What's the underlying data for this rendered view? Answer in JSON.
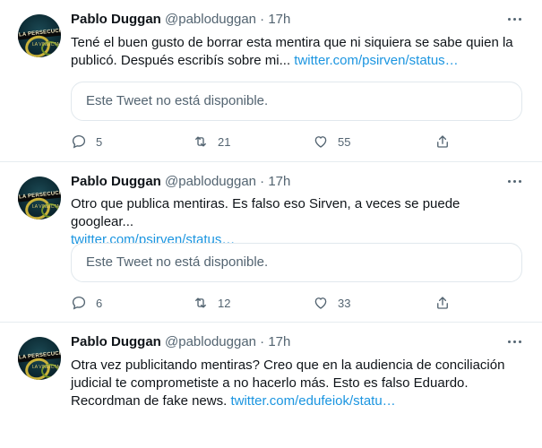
{
  "tweets": [
    {
      "author": "Pablo Duggan",
      "handle": "@pabloduggan",
      "separator": "·",
      "time": "17h",
      "avatar_text": "LA PERSECUCIÓN",
      "avatar_sub": "LA VINDICTA",
      "text_line1": "Tené el buen gusto de borrar esta mentira que ni siquiera se sabe quien la",
      "text_line2": "publicó. Después escribís sobre mi... ",
      "link": "twitter.com/psirven/status…",
      "quote": "Este Tweet no está disponible.",
      "replies": "5",
      "retweets": "21",
      "likes": "55"
    },
    {
      "author": "Pablo Duggan",
      "handle": "@pabloduggan",
      "separator": "·",
      "time": "17h",
      "avatar_text": "LA PERSECUCIÓN",
      "avatar_sub": "LA VINDICTA",
      "text_line1": "Otro que publica mentiras. Es falso eso Sirven, a veces se puede googlear...",
      "link": "twitter.com/psirven/status…",
      "quote": "Este Tweet no está disponible.",
      "replies": "6",
      "retweets": "12",
      "likes": "33"
    },
    {
      "author": "Pablo Duggan",
      "handle": "@pabloduggan",
      "separator": "·",
      "time": "17h",
      "avatar_text": "LA PERSECUCIÓN",
      "avatar_sub": "LA VINDICTA",
      "text_line1": "Otra vez publicitando mentiras? Creo que en la audiencia de conciliación",
      "text_line2": "judicial te comprometiste a no hacerlo más. Esto es falso Eduardo.",
      "text_line3": "Recordman de fake news. ",
      "link": "twitter.com/edufeiok/statu…"
    }
  ],
  "colors": {
    "link": "#1b95e0",
    "muted": "#536471",
    "border": "#e6ecf0"
  },
  "icons": [
    "reply-icon",
    "retweet-icon",
    "like-icon",
    "share-icon",
    "more-icon"
  ]
}
